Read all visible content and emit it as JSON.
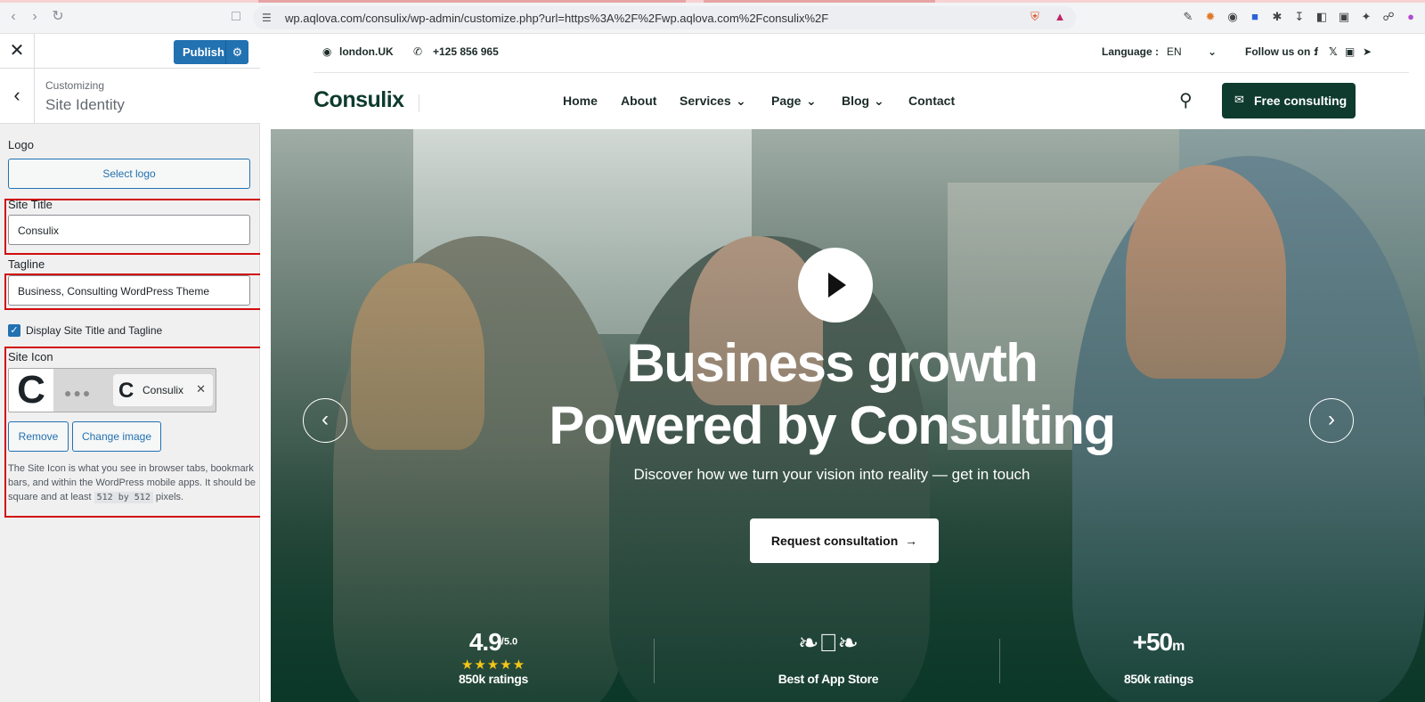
{
  "browser": {
    "url": "wp.aqlova.com/consulix/wp-admin/customize.php?url=https%3A%2F%2Fwp.aqlova.com%2Fconsulix%2F"
  },
  "customizer": {
    "publish_label": "Publish",
    "breadcrumb": "Customizing",
    "section_title": "Site Identity",
    "logo_label": "Logo",
    "select_logo_label": "Select logo",
    "site_title_label": "Site Title",
    "site_title_value": "Consulix",
    "tagline_label": "Tagline",
    "tagline_value": "Business, Consulting WordPress Theme",
    "display_checkbox_label": "Display Site Title and Tagline",
    "display_checkbox_checked": true,
    "site_icon_label": "Site Icon",
    "icon_tab_title": "Consulix",
    "remove_label": "Remove",
    "change_image_label": "Change image",
    "help_part1": "The Site Icon is what you see in browser tabs, bookmark bars, and within the WordPress mobile apps. It should be square and at least",
    "help_code": "512 by 512",
    "help_part2": "pixels."
  },
  "site": {
    "location": "london.UK",
    "phone": "+125 856 965",
    "language_label": "Language :",
    "language_value": "EN",
    "follow_label": "Follow us on :",
    "logo_text": "Consulix",
    "menu": [
      "Home",
      "About",
      "Services",
      "Page",
      "Blog",
      "Contact"
    ],
    "cta_label": "Free consulting",
    "hero_line1": "Business growth",
    "hero_line2": "Powered by Consulting",
    "hero_sub": "Discover how we turn your vision into reality — get in touch",
    "hero_button": "Request consultation",
    "stat1_value": "4.9",
    "stat1_sup": "/5.0",
    "stat1_label": "850k ratings",
    "stat2_label": "Best of App Store",
    "stat3_value": "+50",
    "stat3_sup": "m",
    "stat3_label": "850k ratings"
  },
  "colors": {
    "wp_blue": "#2271b1",
    "brand_green": "#0f3b2e",
    "highlight_red": "#d10c0c"
  }
}
